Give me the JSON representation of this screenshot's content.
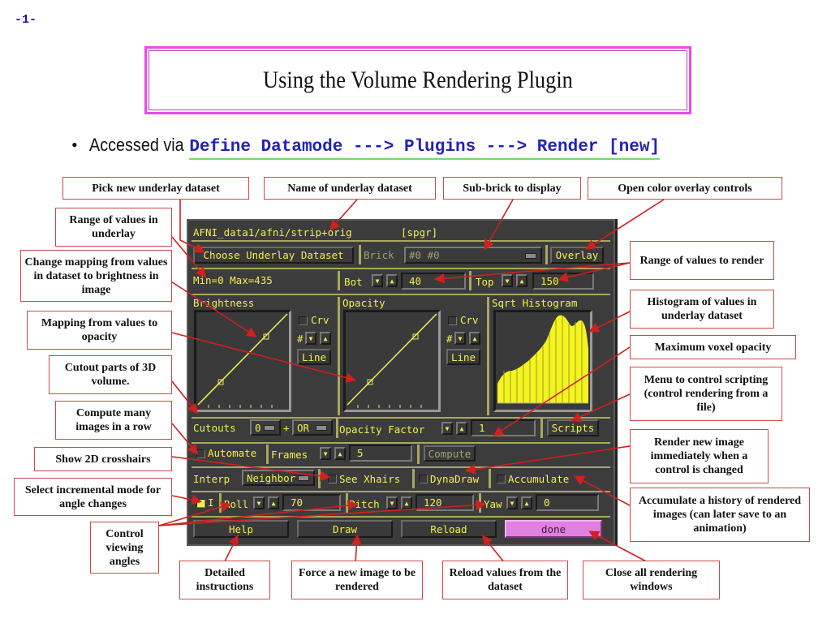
{
  "page_number": "-1-",
  "title": "Using the Volume Rendering Plugin",
  "bullet": {
    "lead": "Accessed via",
    "menu_path": "Define Datamode ---> Plugins ---> Render [new]"
  },
  "callouts": {
    "pick_underlay": "Pick new underlay dataset",
    "name_underlay": "Name of underlay dataset",
    "sub_brick": "Sub-brick to display",
    "open_overlay": "Open color overlay controls",
    "range_underlay": "Range of values in underlay",
    "change_mapping": "Change mapping from values in dataset to brightness in image",
    "mapping_opacity": "Mapping from values to opacity",
    "cutout": "Cutout parts of 3D volume.",
    "compute_many": "Compute many images in a row",
    "show_crosshairs": "Show 2D crosshairs",
    "incremental": "Select incremental mode for angle changes",
    "viewing_angles": "Control viewing angles",
    "range_render": "Range of values to render",
    "histogram": "Histogram of values in underlay dataset",
    "max_opacity": "Maximum voxel opacity",
    "scripting": "Menu to control scripting (control rendering from a file)",
    "dynadraw": "Render new image immediately when a control is changed",
    "accumulate": "Accumulate a history of rendered images (can later save to an animation)",
    "help": "Detailed instructions",
    "draw": "Force a new image to be rendered",
    "reload": "Reload values from the dataset",
    "done": "Close all rendering windows"
  },
  "panel": {
    "dataset_name": "AFNI_data1/afni/strip+orig",
    "dataset_type": "[spgr]",
    "choose_underlay_label": "Choose Underlay Dataset",
    "brick_label": "Brick",
    "brick_value": "#0 #0",
    "overlay_label": "Overlay",
    "range_text": "Min=0 Max=435",
    "bot_label": "Bot",
    "bot_value": "40",
    "top_label": "Top",
    "top_value": "150",
    "brightness_label": "Brightness",
    "opacity_label": "Opacity",
    "histogram_label": "Sqrt Histogram",
    "crv_label": "Crv",
    "hash_label": "#",
    "line_label": "Line",
    "cutouts_label": "Cutouts",
    "cutouts_count": "0",
    "plus": "+",
    "cutouts_logic": "OR",
    "opacity_factor_label": "Opacity Factor",
    "opacity_factor_value": "1",
    "scripts_label": "Scripts",
    "automate_label": "Automate",
    "frames_label": "Frames",
    "frames_value": "5",
    "compute_label": "Compute",
    "interp_label": "Interp",
    "interp_value": "Neighbor",
    "see_xhairs_label": "See Xhairs",
    "dynadraw_label": "DynaDraw",
    "accumulate_label": "Accumulate",
    "incremental_label": "I",
    "incremental_on": true,
    "roll_label": "Roll",
    "roll_value": "70",
    "pitch_label": "Pitch",
    "pitch_value": "120",
    "yaw_label": "Yaw",
    "yaw_value": "0",
    "help_label": "Help",
    "draw_label": "Draw",
    "reload_label": "Reload",
    "done_label": "done"
  },
  "colors": {
    "panel_text": "#f0f050",
    "panel_bg": "#3c3c3c",
    "done_button": "#e080e0",
    "callout_border": "#d04848",
    "menu_path": "#2222b8",
    "title_border": "#e64ce6"
  }
}
